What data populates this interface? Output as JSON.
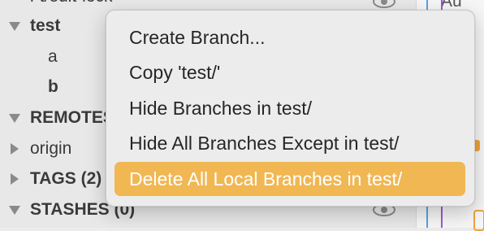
{
  "sidebar": {
    "partial_top": "i-t/edit-lock",
    "items": [
      {
        "label": "test",
        "bold": true,
        "state": "expanded"
      },
      {
        "label": "a",
        "bold": false
      },
      {
        "label": "b",
        "bold": true
      },
      {
        "label": "REMOTES",
        "bold": true,
        "state": "expanded"
      },
      {
        "label": "origin",
        "bold": false,
        "state": "collapsed"
      },
      {
        "label": "TAGS (2)",
        "bold": true,
        "state": "collapsed"
      },
      {
        "label": "STASHES (0)",
        "bold": true,
        "state": "expanded"
      }
    ]
  },
  "context_menu": {
    "items": [
      {
        "label": "Create Branch..."
      },
      {
        "label": "Copy 'test/'"
      },
      {
        "label": "Hide Branches in test/"
      },
      {
        "label": "Hide All Branches Except in test/"
      },
      {
        "label": "Delete All Local Branches in test/",
        "highlighted": true
      }
    ],
    "highlight_color": "#f0b753"
  },
  "icons": {
    "expanded": "triangle-down-icon",
    "collapsed": "triangle-right-icon",
    "visibility": "eye-icon"
  },
  "graph": {
    "colors": [
      "#9b59d0",
      "#f0a33a",
      "#5aa0e0"
    ]
  },
  "graph_partial_text": "Au"
}
